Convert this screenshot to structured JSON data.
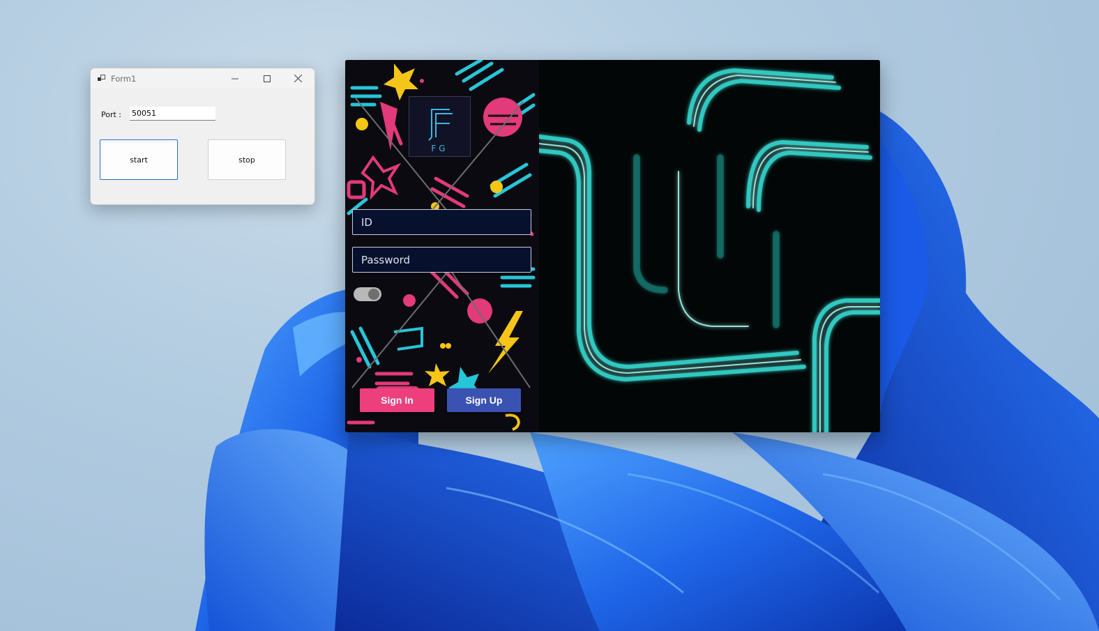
{
  "form1": {
    "title": "Form1",
    "port_label": "Port :",
    "port_value": "50051",
    "start_label": "start",
    "stop_label": "stop",
    "window_buttons": [
      "minimize-icon",
      "maximize-icon",
      "close-icon"
    ]
  },
  "login": {
    "logo_text": "FG",
    "id_placeholder": "ID",
    "password_placeholder": "Password",
    "remember_toggle_on": true,
    "signin_label": "Sign In",
    "signup_label": "Sign Up"
  },
  "colors": {
    "signin": "#ee3f7d",
    "signup": "#3a53b3",
    "field_bg": "#07112e",
    "neon": "#36d6d0",
    "wallpaper_blue": "#1e64e6"
  }
}
